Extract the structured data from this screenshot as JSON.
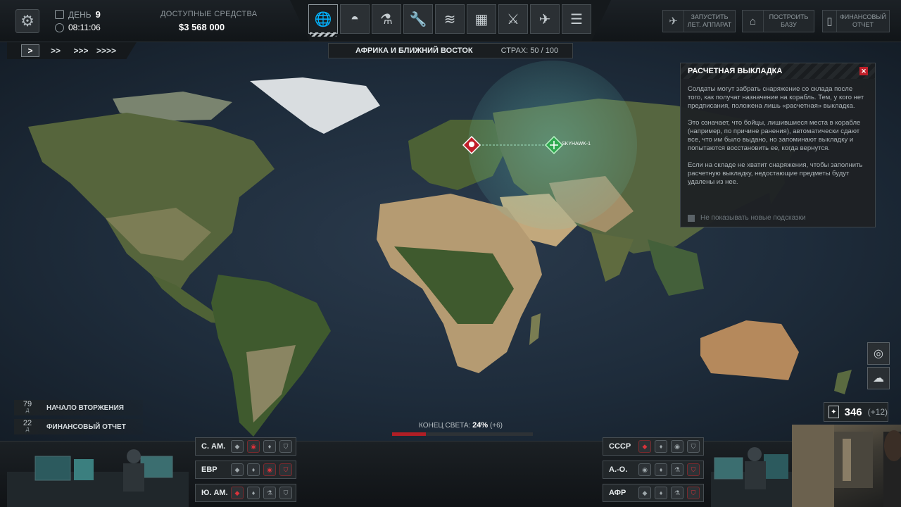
{
  "header": {
    "day_label": "ДЕНЬ",
    "day_value": "9",
    "time": "08:11:06",
    "funds_label": "ДОСТУПНЫЕ СРЕДСТВА",
    "funds_value": "$3 568 000"
  },
  "nav_icons": [
    "globe-icon",
    "base-dome-icon",
    "microscope-icon",
    "wrench-icon",
    "rank-chevrons-icon",
    "building-blocks-icon",
    "rifle-icon",
    "jet-icon",
    "server-rack-icon"
  ],
  "region_bar": {
    "region": "АФРИКА И БЛИЖНИЙ ВОСТОК",
    "fear_label": "СТРАХ:",
    "fear_value": "50 / 100"
  },
  "top_buttons": {
    "launch": "ЗАПУСТИТЬ ЛЕТ. АППАРАТ",
    "build": "ПОСТРОИТЬ БАЗУ",
    "finance": "ФИНАНСОВЫЙ ОТЧЕТ"
  },
  "speed": [
    ">",
    ">>",
    ">>>",
    ">>>>"
  ],
  "map": {
    "aircraft_label": "SKYHAWK-1"
  },
  "tip": {
    "title": "РАСЧЕТНАЯ ВЫКЛАДКА",
    "p1": "Солдаты могут забрать снаряжение со склада после того, как получат назначение на корабль. Тем, у кого нет предписания, положена лишь «расчетная» выкладка.",
    "p2": "Это означает, что бойцы, лишившиеся места в корабле (например, по причине ранения), автоматически сдают все, что им было выдано, но запоминают выкладку и попытаются восстановить ее, когда вернутся.",
    "p3": "Если на складе не хватит снаряжения, чтобы заполнить расчетную выкладку, недостающие предметы будут удалены из нее.",
    "checkbox": "Не показывать новые подсказки"
  },
  "events": [
    {
      "days": "79",
      "unit": "Д",
      "label": "НАЧАЛО ВТОРЖЕНИЯ"
    },
    {
      "days": "22",
      "unit": "Д",
      "label": "ФИНАНСОВЫЙ ОТЧЕТ"
    }
  ],
  "doom": {
    "label": "КОНЕЦ СВЕТА:",
    "value": "24%",
    "delta": "(+6)",
    "progress": 0.24
  },
  "scientists": {
    "value": "346",
    "delta": "(+12)"
  },
  "regions_left": [
    "С. АМ.",
    "ЕВР",
    "Ю. АМ."
  ],
  "regions_right": [
    "СССР",
    "А.-О.",
    "АФР"
  ],
  "colors": {
    "accent_red": "#c0202a",
    "ocean": "#1e2c3b",
    "land": "#5c6b3f",
    "desert": "#b59b72"
  }
}
